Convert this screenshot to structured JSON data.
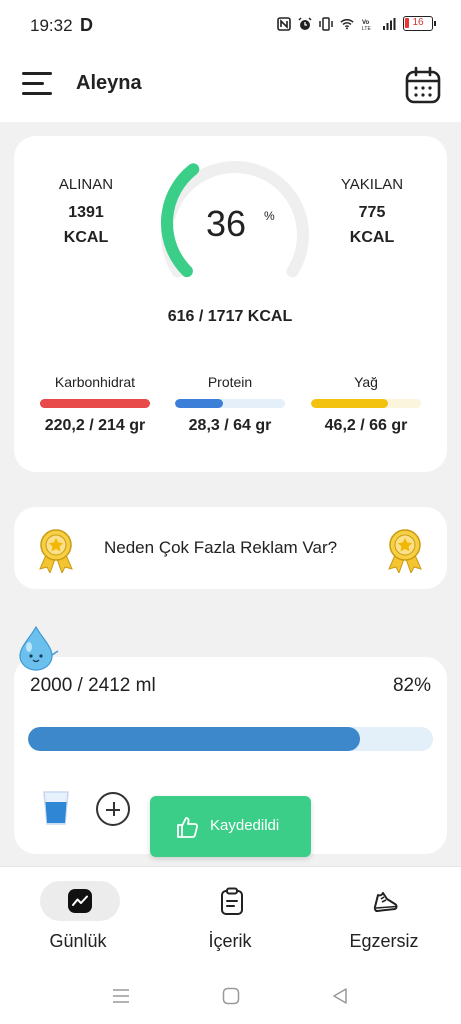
{
  "status_bar": {
    "time": "19:32",
    "carrier_glyph": "D",
    "battery": "16",
    "icons": [
      "nfc-icon",
      "alarm-icon",
      "vibrate-icon",
      "wifi-icon",
      "volte-icon",
      "signal-icon",
      "battery-icon"
    ]
  },
  "header": {
    "username": "Aleyna",
    "menu_icon": "hamburger-menu-icon",
    "calendar_icon": "calendar-icon"
  },
  "summary": {
    "intake_label": "ALINAN",
    "intake_value": "1391",
    "intake_unit": "KCAL",
    "burned_label": "YAKILAN",
    "burned_value": "775",
    "burned_unit": "KCAL",
    "percent_value": "36",
    "percent_sign": "%",
    "percent_fraction": 0.36,
    "kcal_total": "616 / 1717 KCAL"
  },
  "macros": [
    {
      "label": "Karbonhidrat",
      "value": "220,2 / 214 gr",
      "fraction": 1.0,
      "color": "#e84a4a",
      "track": "#e84a4a"
    },
    {
      "label": "Protein",
      "value": "28,3 / 64 gr",
      "fraction": 0.44,
      "color": "#3b7fd9",
      "track": "#e4effa"
    },
    {
      "label": "Yağ",
      "value": "46,2 / 66 gr",
      "fraction": 0.7,
      "color": "#f2c20f",
      "track": "#fbf5dd"
    }
  ],
  "ad_banner": {
    "text": "Neden Çok Fazla Reklam Var?",
    "icon": "award-badge-icon"
  },
  "water": {
    "amount": "2000 / 2412 ml",
    "percent": "82%",
    "fraction": 0.82,
    "glass_icon": "water-glass-icon",
    "add_icon": "plus-circle-icon",
    "mascot_icon": "water-drop-mascot-icon"
  },
  "toast": {
    "text": "Kaydedildi",
    "icon": "thumbs-up-icon"
  },
  "bottom_nav": [
    {
      "label": "Günlük",
      "icon": "chart-trend-icon",
      "active": true
    },
    {
      "label": "İçerik",
      "icon": "clipboard-icon",
      "active": false
    },
    {
      "label": "Egzersiz",
      "icon": "running-shoe-icon",
      "active": false
    }
  ],
  "colors": {
    "accent_green": "#3bce88",
    "water_blue": "#3c88cb",
    "background": "#f1f1f1"
  }
}
